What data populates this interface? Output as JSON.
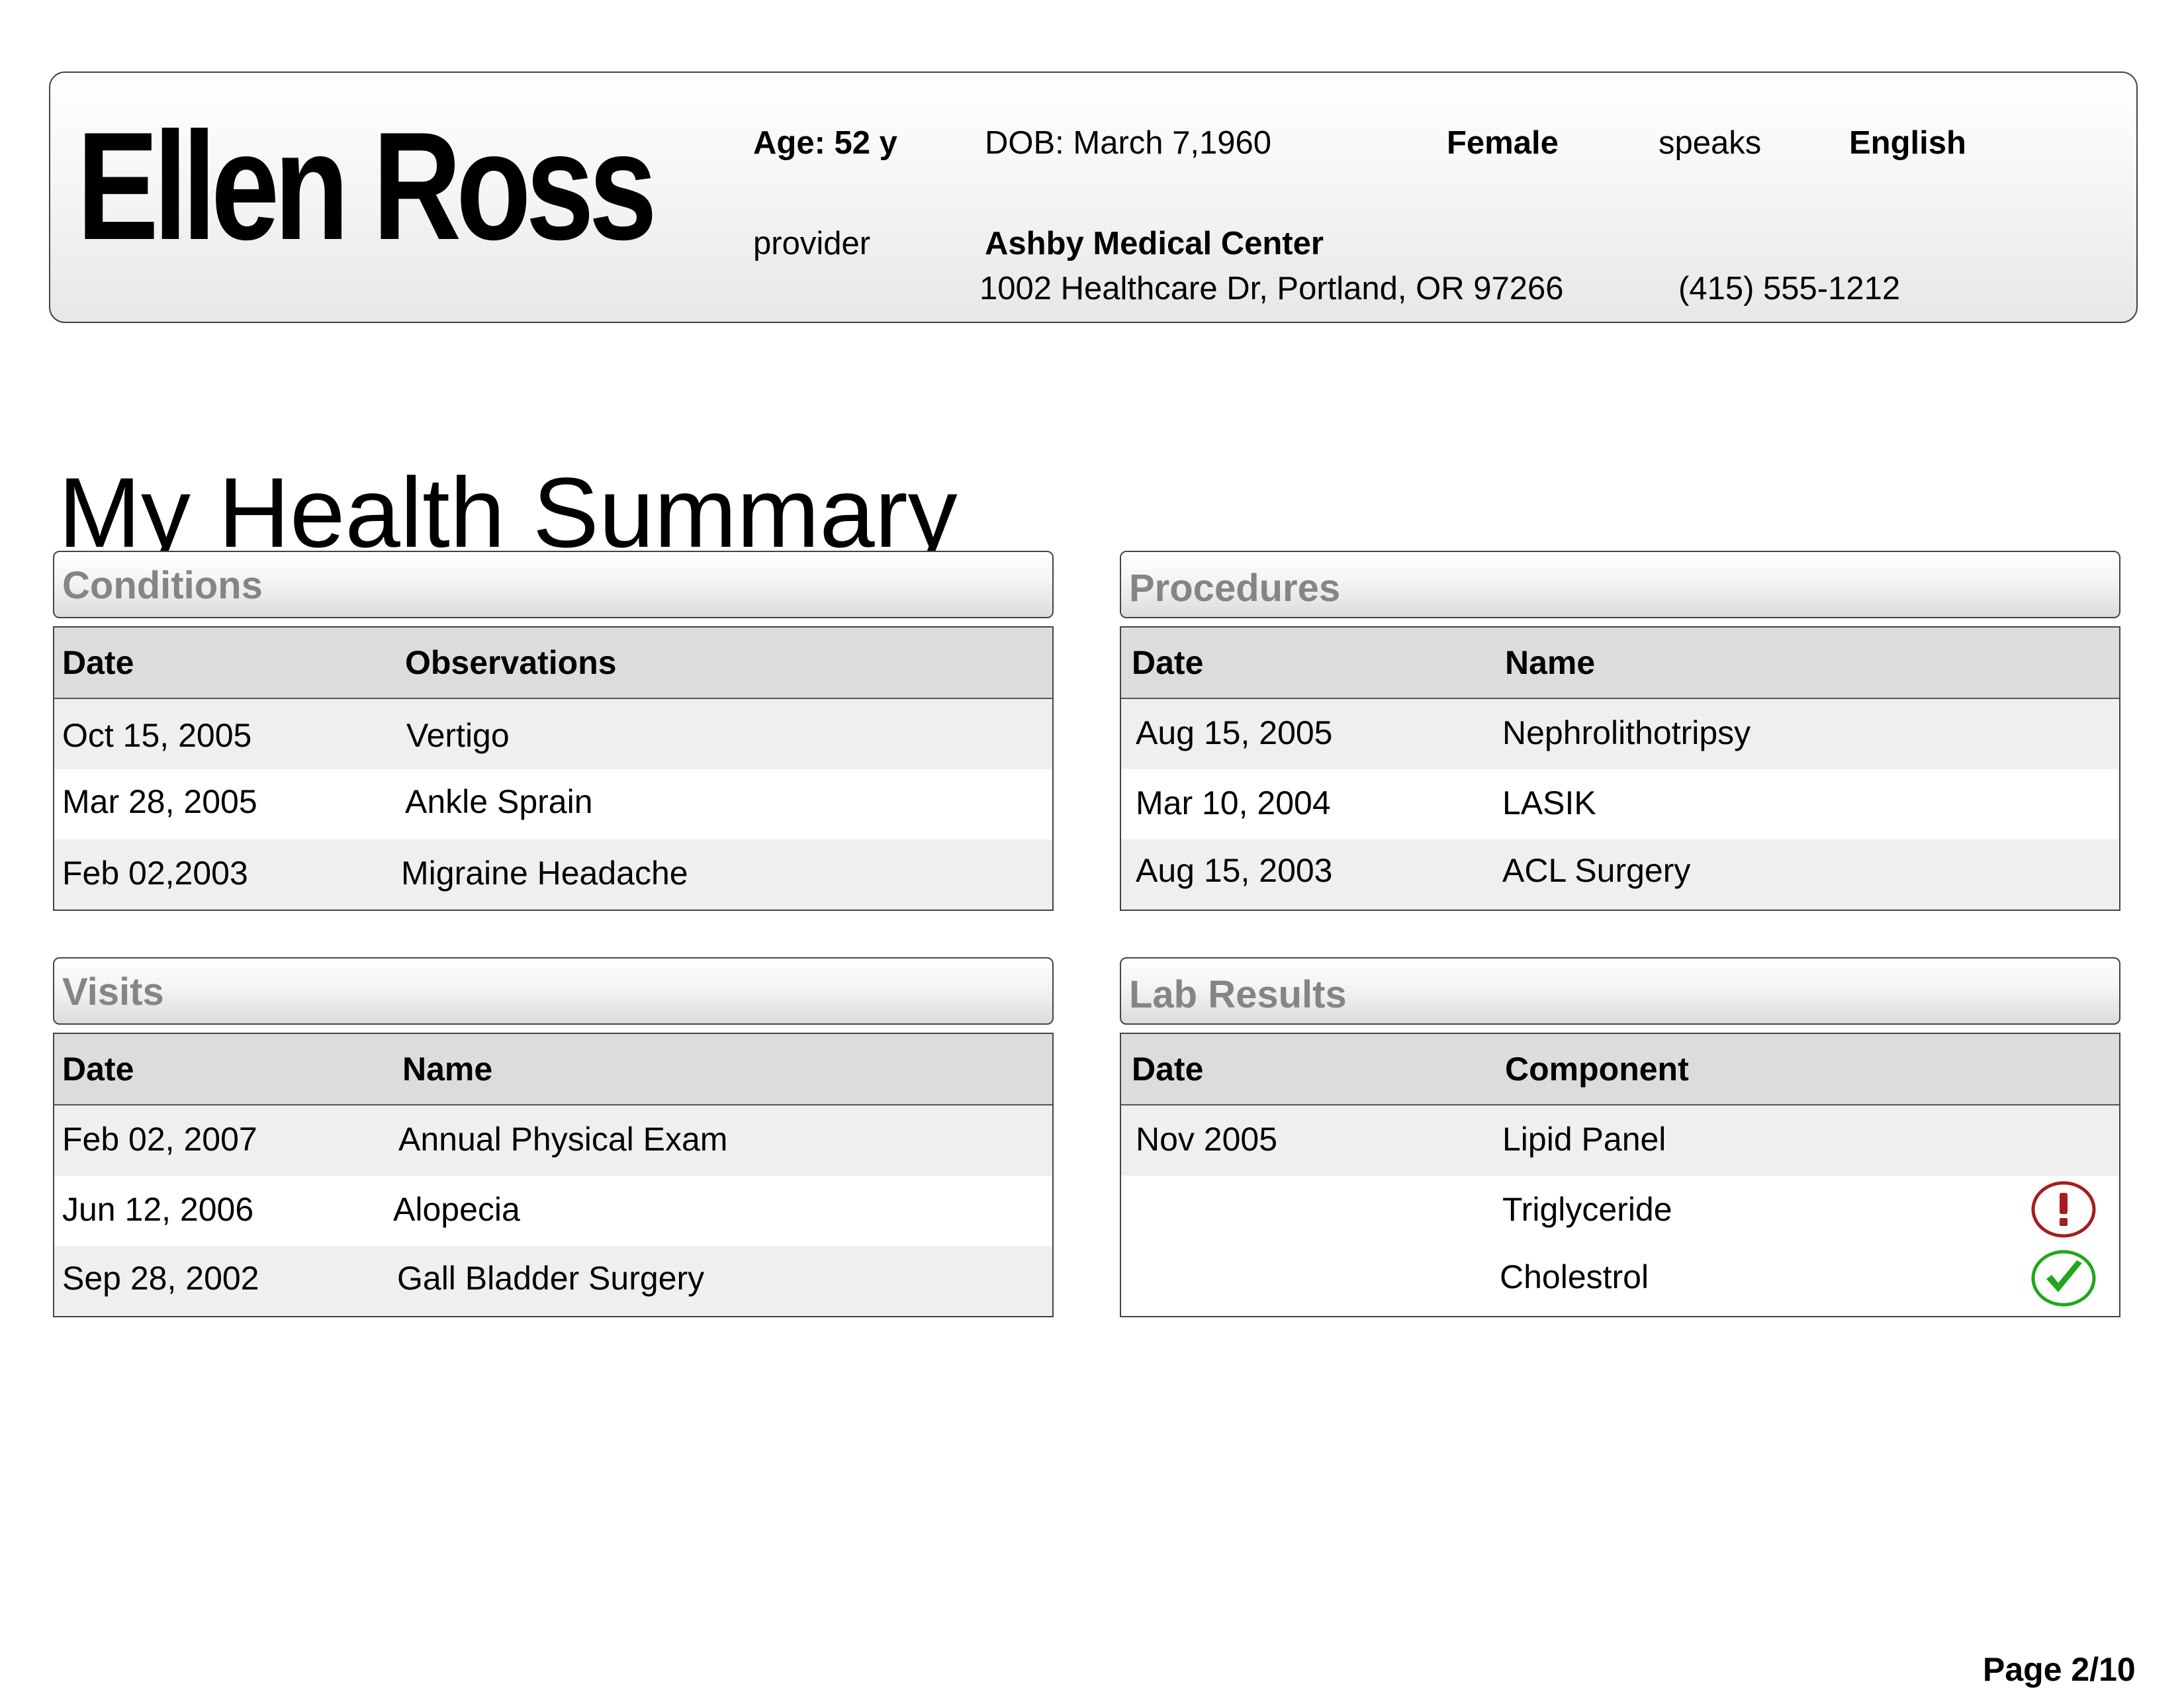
{
  "patient": {
    "name": "Ellen Ross",
    "age": "Age: 52 y",
    "dob": "DOB: March 7,1960",
    "gender": "Female",
    "speaks_label": "speaks",
    "language": "English",
    "provider_label": "provider",
    "provider_name": "Ashby Medical Center",
    "provider_address": "1002 Healthcare Dr, Portland, OR 97266",
    "provider_phone": "(415) 555-1212"
  },
  "page_title": "My Health Summary",
  "conditions": {
    "title": "Conditions",
    "columns": [
      "Date",
      "Observations"
    ],
    "rows": [
      {
        "date": "Oct 15, 2005",
        "value": "Vertigo"
      },
      {
        "date": "Mar 28, 2005",
        "value": "Ankle Sprain"
      },
      {
        "date": "Feb 02,2003",
        "value": "Migraine Headache"
      }
    ]
  },
  "procedures": {
    "title": "Procedures",
    "columns": [
      "Date",
      "Name"
    ],
    "rows": [
      {
        "date": "Aug 15, 2005",
        "value": "Nephrolithotripsy"
      },
      {
        "date": "Mar 10, 2004",
        "value": "LASIK"
      },
      {
        "date": "Aug 15, 2003",
        "value": "ACL Surgery"
      }
    ]
  },
  "visits": {
    "title": "Visits",
    "columns": [
      "Date",
      "Name"
    ],
    "rows": [
      {
        "date": "Feb 02, 2007",
        "value": "Annual Physical Exam"
      },
      {
        "date": "Jun 12, 2006",
        "value": "Alopecia"
      },
      {
        "date": "Sep 28, 2002",
        "value": "Gall Bladder Surgery"
      }
    ]
  },
  "lab_results": {
    "title": "Lab Results",
    "columns": [
      "Date",
      "Component"
    ],
    "rows": [
      {
        "date": "Nov 2005",
        "value": "Lipid Panel",
        "status_icon": ""
      },
      {
        "date": "",
        "value": "Triglyceride",
        "status_icon": "alert-exclamation-icon"
      },
      {
        "date": "",
        "value": "Cholestrol",
        "status_icon": "check-ok-icon"
      }
    ]
  },
  "colors": {
    "alert": "#a51d1d",
    "ok": "#22a61c",
    "section_title": "#858585"
  },
  "page_number": "Page 2/10"
}
